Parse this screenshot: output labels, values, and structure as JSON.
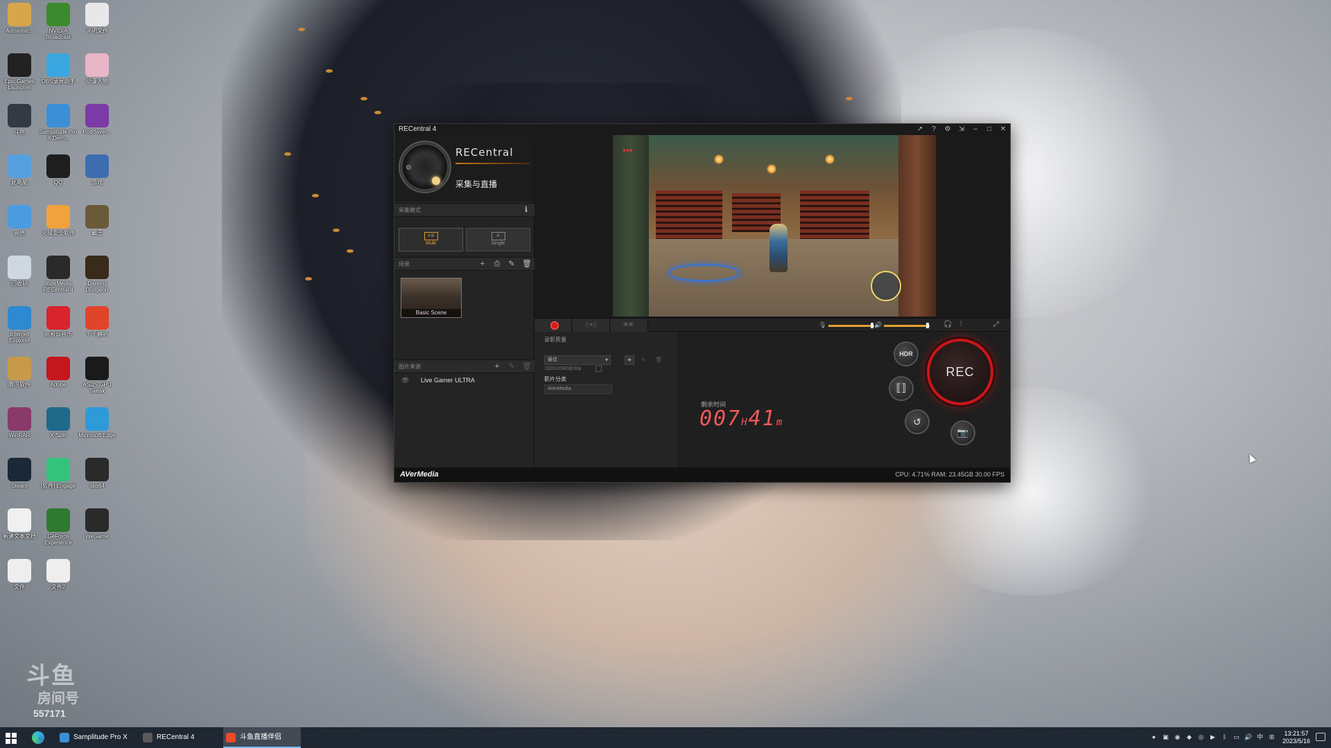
{
  "window": {
    "title": "RECentral 4",
    "logo_wordmark": "RECentral",
    "logo_subtitle": "采集与直播",
    "capture_mode_header": "采集模式",
    "modes": [
      {
        "label": "Multi",
        "icon_text": "A B",
        "active": true
      },
      {
        "label": "Single",
        "icon_text": "A",
        "active": false
      }
    ],
    "scene_header": "场景",
    "scene_name": "Basic Scene",
    "source_header": "图片来源",
    "source_name": "Live Gamer ULTRA",
    "brand": "AVerMedia",
    "stats": "CPU: 4.71%  RAM: 23.45GB  30.00 FPS",
    "settings": {
      "quality_label": "录影质量",
      "quality_value": "最佳",
      "quality_detail": "1920x1080@30p",
      "folder_label": "影片分类",
      "folder_value": "AVerMedia"
    },
    "remaining_label": "剩余时间",
    "remaining_time": "007",
    "remaining_h": "H",
    "remaining_m_value": "41",
    "remaining_m": "m",
    "buttons": {
      "hdr": "HDR",
      "rec": "REC"
    },
    "audio": {
      "mic_level": 0.95,
      "speaker_level": 0.95
    }
  },
  "desktop": {
    "icons": [
      {
        "label": "Administr...",
        "color": "#d7a64a"
      },
      {
        "label": "NVIDIA Broadcast",
        "color": "#3b8a2e"
      },
      {
        "label": "说明文件",
        "color": "#e8e8e8"
      },
      {
        "label": "Epic Games Launcher",
        "color": "#222222"
      },
      {
        "label": "OBS录屏助手",
        "color": "#3aa7e0"
      },
      {
        "label": "动漫人物",
        "color": "#e9b6c8"
      },
      {
        "label": "斗鱼",
        "color": "#333a44"
      },
      {
        "label": "Samplitude Pro X Dem...",
        "color": "#3b8fd6"
      },
      {
        "label": "PotPlayer...",
        "color": "#7b3aa8"
      },
      {
        "label": "此电脑",
        "color": "#56a0e0"
      },
      {
        "label": "QQ",
        "color": "#1e1e1e"
      },
      {
        "label": "游戏",
        "color": "#3d6db0"
      },
      {
        "label": "网络",
        "color": "#4b9be0"
      },
      {
        "label": "火绒安全软件",
        "color": "#f2a23a"
      },
      {
        "label": "霸王",
        "color": "#6a5a3a"
      },
      {
        "label": "回收站",
        "color": "#cfd8e0"
      },
      {
        "label": "AVerMedia RECentral 4",
        "color": "#2a2a2a"
      },
      {
        "label": "Darkest Dungeon",
        "color": "#3a2a1a"
      },
      {
        "label": "Internet Explorer",
        "color": "#2e8ad0"
      },
      {
        "label": "网易云音乐",
        "color": "#d9232d"
      },
      {
        "label": "千千静听",
        "color": "#e0442a"
      },
      {
        "label": "腾讯软件",
        "color": "#c79a4a"
      },
      {
        "label": "Adobe",
        "color": "#c4161c"
      },
      {
        "label": "ASUS GPU Tweak",
        "color": "#1a1a1a"
      },
      {
        "label": "WinRAR",
        "color": "#8a3a6a"
      },
      {
        "label": "X-Split",
        "color": "#1f6a8a"
      },
      {
        "label": "Microsoft Edge",
        "color": "#2e9ad8"
      },
      {
        "label": "Steam",
        "color": "#1b2838"
      },
      {
        "label": "[软件] Engage",
        "color": "#34c37a"
      },
      {
        "label": "obs64",
        "color": "#2a2a2a"
      },
      {
        "label": "新建文本文档",
        "color": "#f0f0f0"
      },
      {
        "label": "GeForce Experience",
        "color": "#2e7a2e"
      },
      {
        "label": "WeGame",
        "color": "#2a2a2a"
      },
      {
        "label": "文件",
        "color": "#eeeeee"
      },
      {
        "label": "文件2",
        "color": "#eeeeee"
      }
    ]
  },
  "watermark": {
    "line1": "斗鱼",
    "line2": "房间号",
    "number": "557171"
  },
  "taskbar": {
    "apps": [
      {
        "label": "Samplitude Pro X ...",
        "color": "#3b8fd6",
        "active": false
      },
      {
        "label": "RECentral 4",
        "color": "#5a5a5a",
        "active": false
      },
      {
        "label": "斗鱼直播伴侣",
        "color": "#e84a2a",
        "active": true
      }
    ],
    "time": "13:21:57",
    "date": "2023/5/16",
    "ime": "中"
  }
}
